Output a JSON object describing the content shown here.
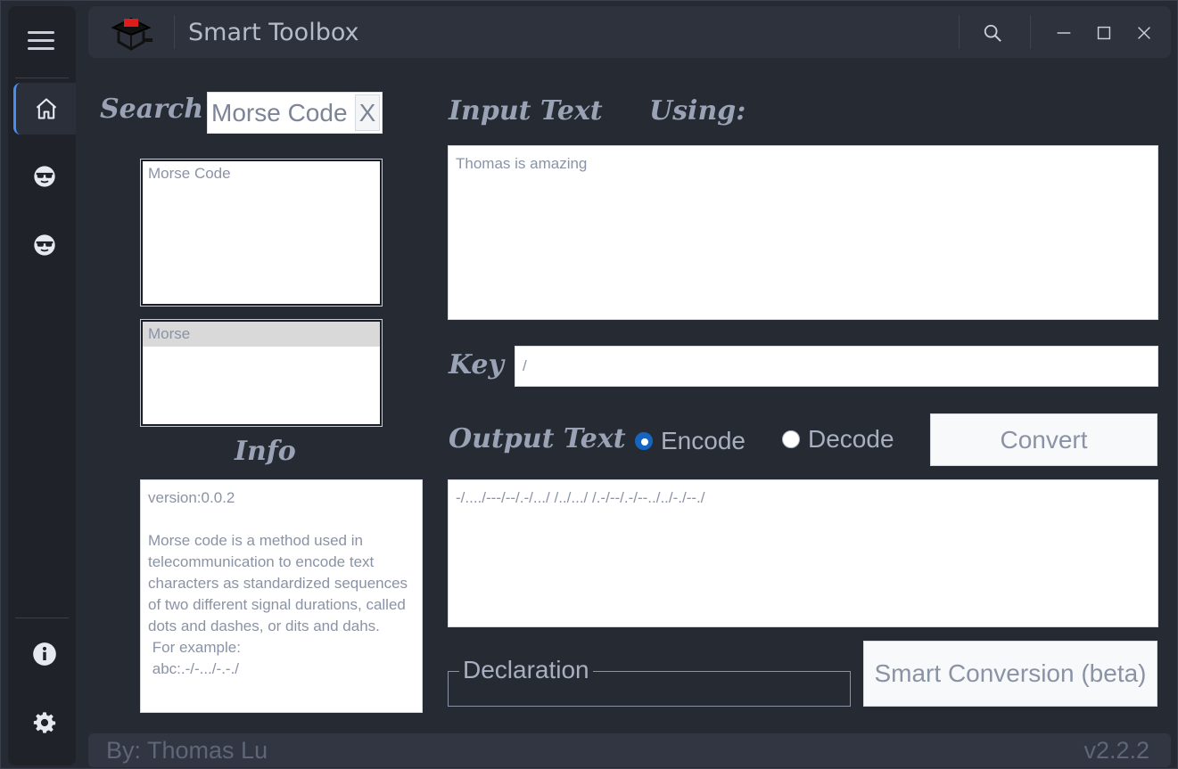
{
  "app": {
    "title": "Smart Toolbox"
  },
  "sidebar": {
    "items": [
      {
        "icon": "home-icon"
      },
      {
        "icon": "sunglasses-face-icon"
      },
      {
        "icon": "sunglasses-face-icon"
      },
      {
        "icon": "info-icon"
      },
      {
        "icon": "gear-icon"
      }
    ]
  },
  "search": {
    "label": "Search",
    "value": "Morse Code",
    "clear_label": "X"
  },
  "tools_list": {
    "items": [
      "Morse Code"
    ]
  },
  "variants_list": {
    "items": [
      "Morse"
    ],
    "selected": "Morse"
  },
  "info": {
    "heading": "Info",
    "text": "version:0.0.2\n\nMorse code is a method used in telecommunication to encode text characters as standardized sequences of two different signal durations, called dots and dashes, or dits and dahs.\n For example:\n abc:.-/-.../-.-./"
  },
  "input": {
    "heading": "Input Text",
    "using_label": "Using:",
    "value": "Thomas is amazing"
  },
  "key": {
    "label": "Key",
    "value": "/"
  },
  "output": {
    "heading": "Output Text",
    "encode_label": "Encode",
    "decode_label": "Decode",
    "mode": "encode",
    "convert_label": "Convert",
    "value": "-/..../---/--/.-/.../ /../.../ /.-/--/.-/--../../-./--./"
  },
  "declaration": {
    "label": "Declaration"
  },
  "smart_conversion": {
    "label": "Smart Conversion (beta)"
  },
  "footer": {
    "author": "By: Thomas Lu",
    "version": "v2.2.2"
  },
  "colors": {
    "accent": "#4a8df0",
    "radio_on": "#1565c0",
    "logo_red": "#e01b1b"
  }
}
